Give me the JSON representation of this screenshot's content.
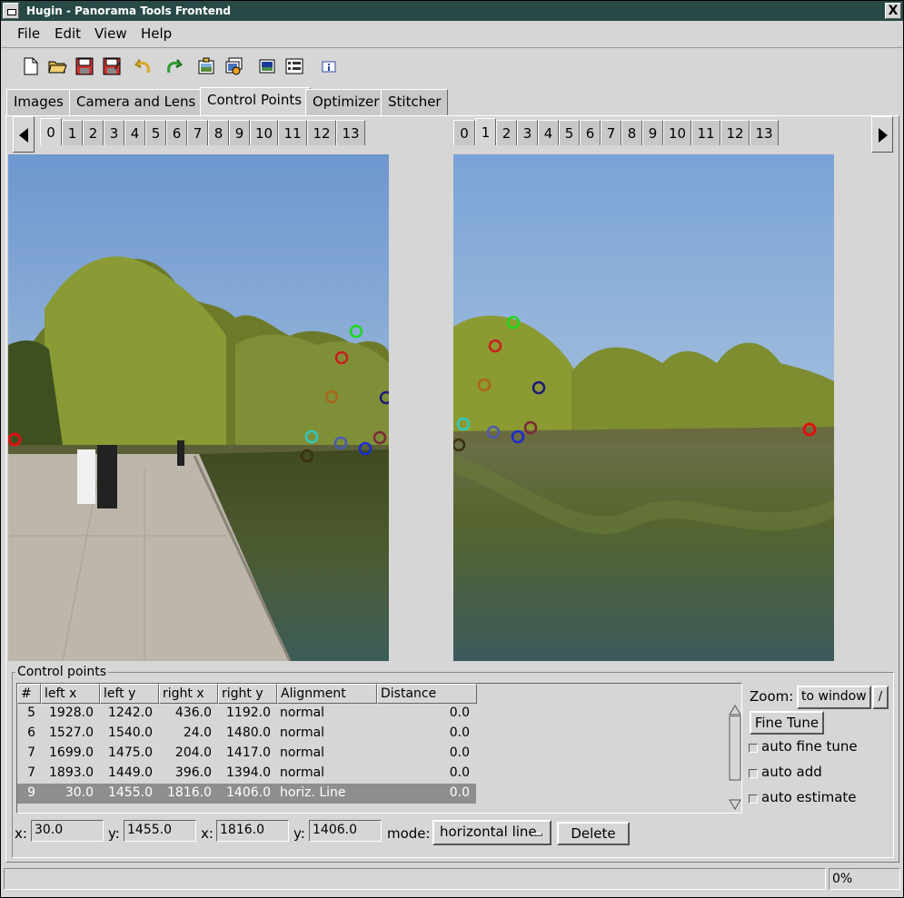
{
  "window": {
    "title": "Hugin - Panorama Tools Frontend",
    "close_glyph": "X"
  },
  "menu": [
    "File",
    "Edit",
    "View",
    "Help"
  ],
  "toolbar_icons": [
    "new-file-icon",
    "open-folder-icon",
    "save-icon",
    "save-as-icon",
    "undo-icon",
    "redo-icon",
    "add-image-icon",
    "add-series-icon",
    "preview-icon",
    "list-icon",
    "info-icon"
  ],
  "main_tabs": [
    "Images",
    "Camera and Lens",
    "Control Points",
    "Optimizer",
    "Stitcher"
  ],
  "active_main_tab": "Control Points",
  "left_image_tabs": [
    "0",
    "1",
    "2",
    "3",
    "4",
    "5",
    "6",
    "7",
    "8",
    "9",
    "10",
    "11",
    "12",
    "13"
  ],
  "left_active": "0",
  "right_image_tabs": [
    "0",
    "1",
    "2",
    "3",
    "4",
    "5",
    "6",
    "7",
    "8",
    "9",
    "10",
    "11",
    "12",
    "13"
  ],
  "right_active": "1",
  "control_points": {
    "group_label": "Control points",
    "columns": [
      "#",
      "left x",
      "left y",
      "right x",
      "right y",
      "Alignment",
      "Distance"
    ],
    "rows": [
      [
        "5",
        "1928.0",
        "1242.0",
        "436.0",
        "1192.0",
        "normal",
        "0.0"
      ],
      [
        "6",
        "1527.0",
        "1540.0",
        "24.0",
        "1480.0",
        "normal",
        "0.0"
      ],
      [
        "7",
        "1699.0",
        "1475.0",
        "204.0",
        "1417.0",
        "normal",
        "0.0"
      ],
      [
        "7",
        "1893.0",
        "1449.0",
        "396.0",
        "1394.0",
        "normal",
        "0.0"
      ],
      [
        "9",
        "30.0",
        "1455.0",
        "1816.0",
        "1406.0",
        "horiz. Line",
        "0.0"
      ]
    ],
    "selected_row": 4
  },
  "edit": {
    "x_label": "x:",
    "x_value": "30.0",
    "y_label": "y:",
    "y_value": "1455.0",
    "x2_label": "x:",
    "x2_value": "1816.0",
    "y2_label": "y:",
    "y2_value": "1406.0",
    "mode_label": "mode:",
    "mode_value": "horizontal line",
    "delete_label": "Delete"
  },
  "side": {
    "zoom_label": "Zoom:",
    "zoom_value": "to window",
    "zoom_btn": "/",
    "fine_tune": "Fine Tune",
    "auto_fine_tune": "auto fine tune",
    "auto_add": "auto add",
    "auto_estimate": "auto estimate"
  },
  "status": {
    "progress": "0%"
  },
  "colors": {
    "titlebar": "#274a47",
    "selected_row": "#8e8e8e",
    "bg": "#d6d6d6"
  }
}
